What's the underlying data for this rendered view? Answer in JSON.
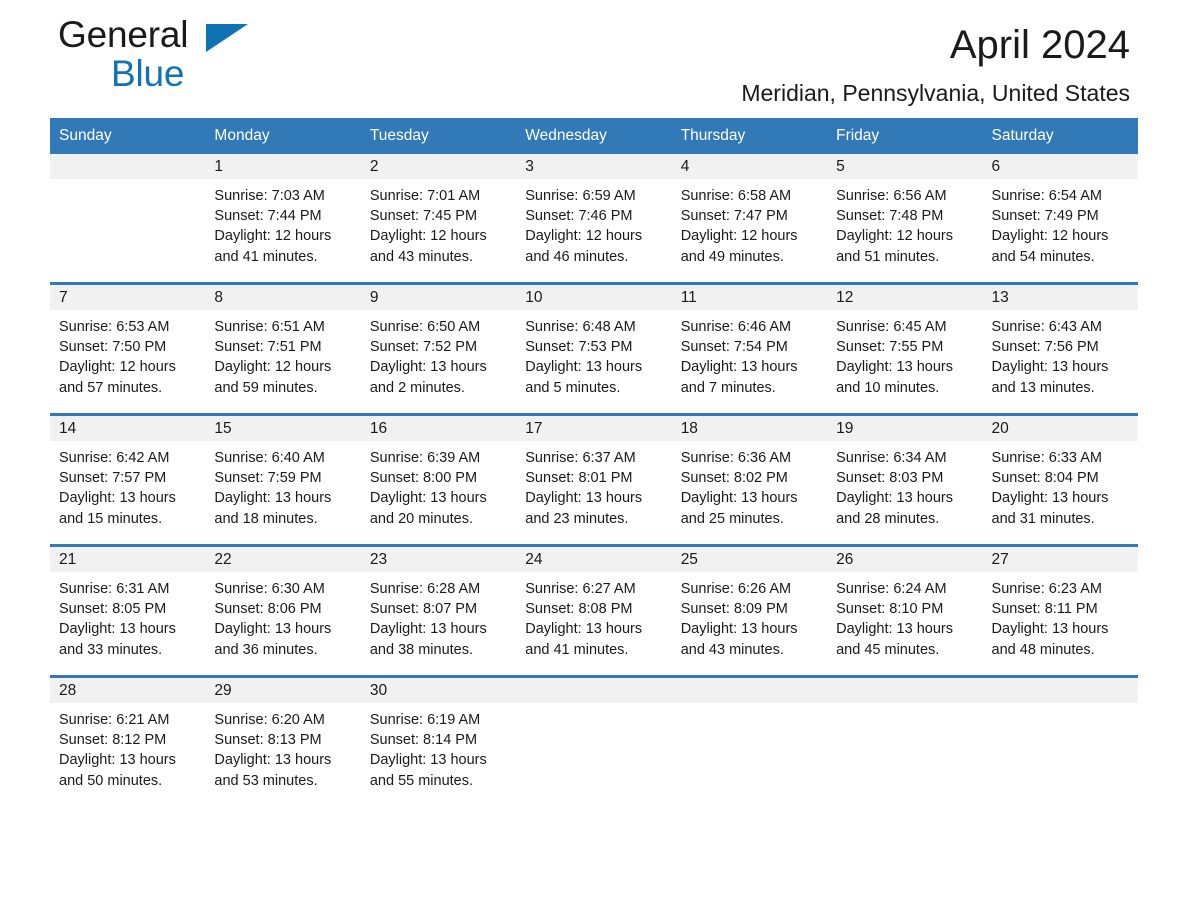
{
  "brand": {
    "name_part1": "General",
    "name_part2": "Blue",
    "triangle_color": "#0f72b5",
    "blue_text_color": "#1272b7"
  },
  "header": {
    "title": "April 2024",
    "location": "Meridian, Pennsylvania, United States"
  },
  "theme": {
    "header_blue": "#3179b7",
    "daynum_band": "#f1f1f1",
    "text": "#1a1a1a"
  },
  "calendar": {
    "weekday_headers": [
      "Sunday",
      "Monday",
      "Tuesday",
      "Wednesday",
      "Thursday",
      "Friday",
      "Saturday"
    ],
    "weeks": [
      [
        {
          "day": "",
          "sunrise": "",
          "sunset": "",
          "daylight_line1": "",
          "daylight_line2": ""
        },
        {
          "day": "1",
          "sunrise": "Sunrise: 7:03 AM",
          "sunset": "Sunset: 7:44 PM",
          "daylight_line1": "Daylight: 12 hours",
          "daylight_line2": "and 41 minutes."
        },
        {
          "day": "2",
          "sunrise": "Sunrise: 7:01 AM",
          "sunset": "Sunset: 7:45 PM",
          "daylight_line1": "Daylight: 12 hours",
          "daylight_line2": "and 43 minutes."
        },
        {
          "day": "3",
          "sunrise": "Sunrise: 6:59 AM",
          "sunset": "Sunset: 7:46 PM",
          "daylight_line1": "Daylight: 12 hours",
          "daylight_line2": "and 46 minutes."
        },
        {
          "day": "4",
          "sunrise": "Sunrise: 6:58 AM",
          "sunset": "Sunset: 7:47 PM",
          "daylight_line1": "Daylight: 12 hours",
          "daylight_line2": "and 49 minutes."
        },
        {
          "day": "5",
          "sunrise": "Sunrise: 6:56 AM",
          "sunset": "Sunset: 7:48 PM",
          "daylight_line1": "Daylight: 12 hours",
          "daylight_line2": "and 51 minutes."
        },
        {
          "day": "6",
          "sunrise": "Sunrise: 6:54 AM",
          "sunset": "Sunset: 7:49 PM",
          "daylight_line1": "Daylight: 12 hours",
          "daylight_line2": "and 54 minutes."
        }
      ],
      [
        {
          "day": "7",
          "sunrise": "Sunrise: 6:53 AM",
          "sunset": "Sunset: 7:50 PM",
          "daylight_line1": "Daylight: 12 hours",
          "daylight_line2": "and 57 minutes."
        },
        {
          "day": "8",
          "sunrise": "Sunrise: 6:51 AM",
          "sunset": "Sunset: 7:51 PM",
          "daylight_line1": "Daylight: 12 hours",
          "daylight_line2": "and 59 minutes."
        },
        {
          "day": "9",
          "sunrise": "Sunrise: 6:50 AM",
          "sunset": "Sunset: 7:52 PM",
          "daylight_line1": "Daylight: 13 hours",
          "daylight_line2": "and 2 minutes."
        },
        {
          "day": "10",
          "sunrise": "Sunrise: 6:48 AM",
          "sunset": "Sunset: 7:53 PM",
          "daylight_line1": "Daylight: 13 hours",
          "daylight_line2": "and 5 minutes."
        },
        {
          "day": "11",
          "sunrise": "Sunrise: 6:46 AM",
          "sunset": "Sunset: 7:54 PM",
          "daylight_line1": "Daylight: 13 hours",
          "daylight_line2": "and 7 minutes."
        },
        {
          "day": "12",
          "sunrise": "Sunrise: 6:45 AM",
          "sunset": "Sunset: 7:55 PM",
          "daylight_line1": "Daylight: 13 hours",
          "daylight_line2": "and 10 minutes."
        },
        {
          "day": "13",
          "sunrise": "Sunrise: 6:43 AM",
          "sunset": "Sunset: 7:56 PM",
          "daylight_line1": "Daylight: 13 hours",
          "daylight_line2": "and 13 minutes."
        }
      ],
      [
        {
          "day": "14",
          "sunrise": "Sunrise: 6:42 AM",
          "sunset": "Sunset: 7:57 PM",
          "daylight_line1": "Daylight: 13 hours",
          "daylight_line2": "and 15 minutes."
        },
        {
          "day": "15",
          "sunrise": "Sunrise: 6:40 AM",
          "sunset": "Sunset: 7:59 PM",
          "daylight_line1": "Daylight: 13 hours",
          "daylight_line2": "and 18 minutes."
        },
        {
          "day": "16",
          "sunrise": "Sunrise: 6:39 AM",
          "sunset": "Sunset: 8:00 PM",
          "daylight_line1": "Daylight: 13 hours",
          "daylight_line2": "and 20 minutes."
        },
        {
          "day": "17",
          "sunrise": "Sunrise: 6:37 AM",
          "sunset": "Sunset: 8:01 PM",
          "daylight_line1": "Daylight: 13 hours",
          "daylight_line2": "and 23 minutes."
        },
        {
          "day": "18",
          "sunrise": "Sunrise: 6:36 AM",
          "sunset": "Sunset: 8:02 PM",
          "daylight_line1": "Daylight: 13 hours",
          "daylight_line2": "and 25 minutes."
        },
        {
          "day": "19",
          "sunrise": "Sunrise: 6:34 AM",
          "sunset": "Sunset: 8:03 PM",
          "daylight_line1": "Daylight: 13 hours",
          "daylight_line2": "and 28 minutes."
        },
        {
          "day": "20",
          "sunrise": "Sunrise: 6:33 AM",
          "sunset": "Sunset: 8:04 PM",
          "daylight_line1": "Daylight: 13 hours",
          "daylight_line2": "and 31 minutes."
        }
      ],
      [
        {
          "day": "21",
          "sunrise": "Sunrise: 6:31 AM",
          "sunset": "Sunset: 8:05 PM",
          "daylight_line1": "Daylight: 13 hours",
          "daylight_line2": "and 33 minutes."
        },
        {
          "day": "22",
          "sunrise": "Sunrise: 6:30 AM",
          "sunset": "Sunset: 8:06 PM",
          "daylight_line1": "Daylight: 13 hours",
          "daylight_line2": "and 36 minutes."
        },
        {
          "day": "23",
          "sunrise": "Sunrise: 6:28 AM",
          "sunset": "Sunset: 8:07 PM",
          "daylight_line1": "Daylight: 13 hours",
          "daylight_line2": "and 38 minutes."
        },
        {
          "day": "24",
          "sunrise": "Sunrise: 6:27 AM",
          "sunset": "Sunset: 8:08 PM",
          "daylight_line1": "Daylight: 13 hours",
          "daylight_line2": "and 41 minutes."
        },
        {
          "day": "25",
          "sunrise": "Sunrise: 6:26 AM",
          "sunset": "Sunset: 8:09 PM",
          "daylight_line1": "Daylight: 13 hours",
          "daylight_line2": "and 43 minutes."
        },
        {
          "day": "26",
          "sunrise": "Sunrise: 6:24 AM",
          "sunset": "Sunset: 8:10 PM",
          "daylight_line1": "Daylight: 13 hours",
          "daylight_line2": "and 45 minutes."
        },
        {
          "day": "27",
          "sunrise": "Sunrise: 6:23 AM",
          "sunset": "Sunset: 8:11 PM",
          "daylight_line1": "Daylight: 13 hours",
          "daylight_line2": "and 48 minutes."
        }
      ],
      [
        {
          "day": "28",
          "sunrise": "Sunrise: 6:21 AM",
          "sunset": "Sunset: 8:12 PM",
          "daylight_line1": "Daylight: 13 hours",
          "daylight_line2": "and 50 minutes."
        },
        {
          "day": "29",
          "sunrise": "Sunrise: 6:20 AM",
          "sunset": "Sunset: 8:13 PM",
          "daylight_line1": "Daylight: 13 hours",
          "daylight_line2": "and 53 minutes."
        },
        {
          "day": "30",
          "sunrise": "Sunrise: 6:19 AM",
          "sunset": "Sunset: 8:14 PM",
          "daylight_line1": "Daylight: 13 hours",
          "daylight_line2": "and 55 minutes."
        },
        {
          "day": "",
          "sunrise": "",
          "sunset": "",
          "daylight_line1": "",
          "daylight_line2": ""
        },
        {
          "day": "",
          "sunrise": "",
          "sunset": "",
          "daylight_line1": "",
          "daylight_line2": ""
        },
        {
          "day": "",
          "sunrise": "",
          "sunset": "",
          "daylight_line1": "",
          "daylight_line2": ""
        },
        {
          "day": "",
          "sunrise": "",
          "sunset": "",
          "daylight_line1": "",
          "daylight_line2": ""
        }
      ]
    ]
  }
}
